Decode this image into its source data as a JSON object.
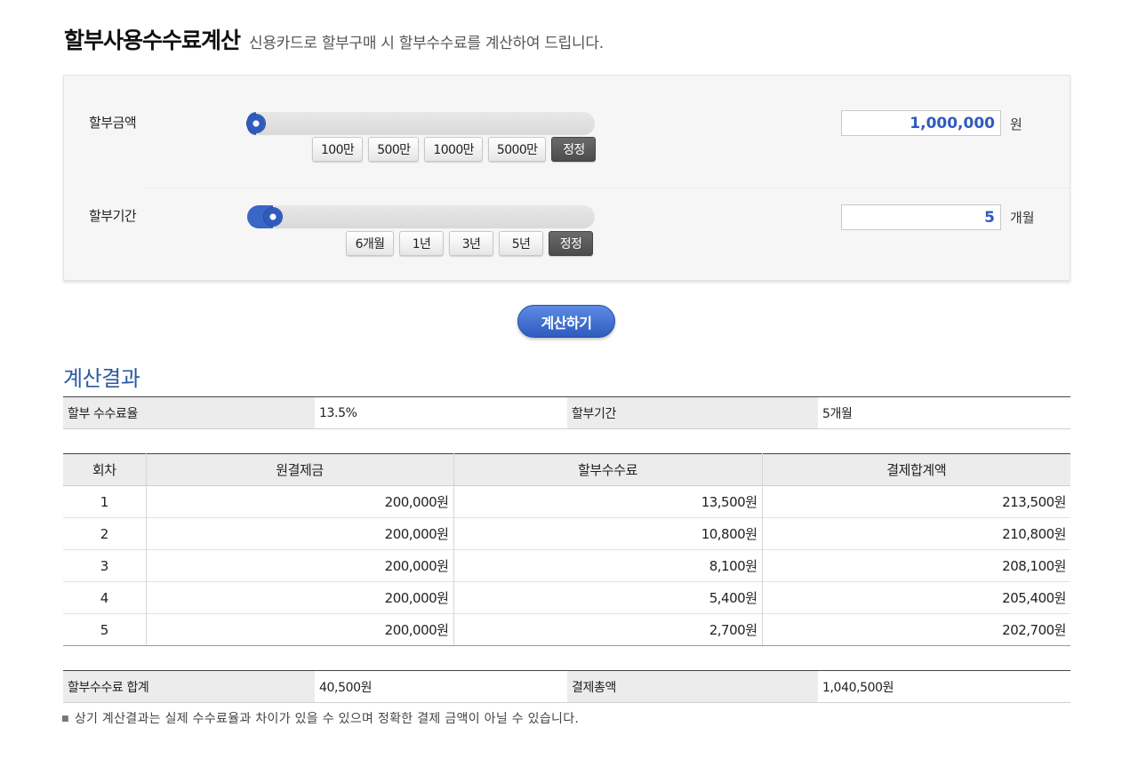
{
  "header": {
    "title": "할부사용수수료계산",
    "subtitle": "신용카드로 할부구매 시 할부수수료를 계산하여 드립니다."
  },
  "amount": {
    "label": "할부금액",
    "slider_level": 0.0,
    "presets": [
      "100만",
      "500만",
      "1000만",
      "5000만"
    ],
    "reset_label": "정정",
    "value": "1,000,000",
    "unit": "원"
  },
  "period": {
    "label": "할부기간",
    "slider_level": 0.05,
    "presets": [
      "6개월",
      "1년",
      "3년",
      "5년"
    ],
    "reset_label": "정정",
    "value": "5",
    "unit": "개월"
  },
  "calculate_label": "계산하기",
  "result": {
    "heading": "계산결과",
    "summary": {
      "rate_label": "할부 수수료율",
      "rate_value": "13.5%",
      "period_label": "할부기간",
      "period_value": "5개월"
    },
    "schedule": {
      "columns": [
        "회차",
        "원결제금",
        "할부수수료",
        "결제합계액"
      ],
      "rows": [
        [
          "1",
          "200,000원",
          "13,500원",
          "213,500원"
        ],
        [
          "2",
          "200,000원",
          "10,800원",
          "210,800원"
        ],
        [
          "3",
          "200,000원",
          "8,100원",
          "208,100원"
        ],
        [
          "4",
          "200,000원",
          "5,400원",
          "205,400원"
        ],
        [
          "5",
          "200,000원",
          "2,700원",
          "202,700원"
        ]
      ]
    },
    "totals": {
      "fee_label": "할부수수료 합계",
      "fee_value": "40,500원",
      "payment_label": "결제총액",
      "payment_value": "1,040,500원"
    },
    "footnote": "상기 계산결과는 실제 수수료율과 차이가 있을 수 있으며 정확한 결제 금액이 아닐 수 있습니다."
  },
  "colors": {
    "accent": "#2f5bbf",
    "heading": "#2b5aa3"
  }
}
